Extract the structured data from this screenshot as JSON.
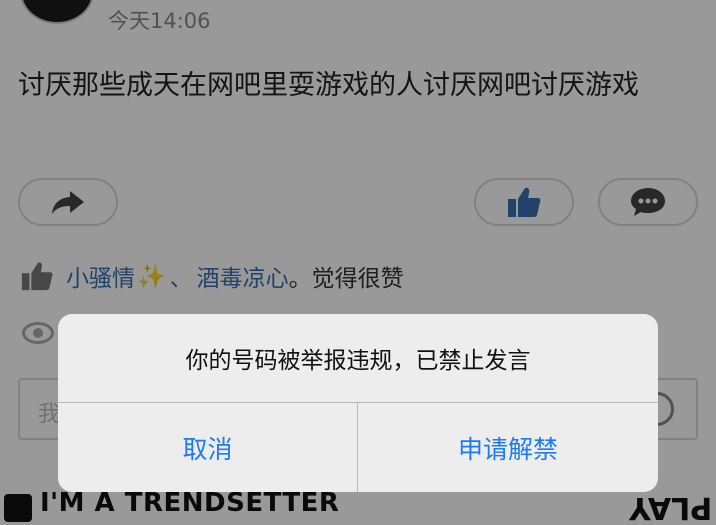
{
  "post": {
    "time": "今天14:06",
    "text": "讨厌那些成天在网吧里耍游戏的人讨厌网吧讨厌游戏"
  },
  "actions": {
    "share_icon": "share-arrow-icon",
    "like_icon": "thumbs-up-icon",
    "comment_icon": "chat-bubble-icon"
  },
  "likes": {
    "liker1": "小骚情",
    "liker1_emoji": "✨",
    "separator": "、",
    "liker2": "酒毒凉心",
    "suffix": "。觉得很赞"
  },
  "comment_box": {
    "placeholder": "我"
  },
  "banner": {
    "text": "I'M A TRENDSETTER",
    "right_text": "PLAY"
  },
  "dialog": {
    "message": "你的号码被举报违规，已禁止发言",
    "cancel_label": "取消",
    "appeal_label": "申请解禁"
  },
  "colors": {
    "accent_blue": "#1e7cf0",
    "liker_blue": "#3a6fb0",
    "dim_overlay": "rgba(0,0,0,0.40)"
  }
}
